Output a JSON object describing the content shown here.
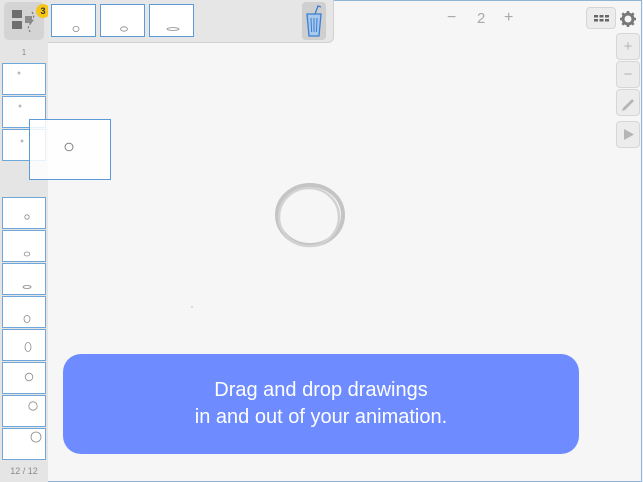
{
  "left_panel": {
    "layers_badge": "3",
    "top_frame_number": "1",
    "frame_count": "12 / 12"
  },
  "top_bar": {
    "frame_number": "2",
    "minus_label": "−",
    "plus_label": "+"
  },
  "side_toolbar": {
    "zoom_in_label": "+",
    "zoom_out_label": "−"
  },
  "callout": {
    "line1": "Drag and drop drawings",
    "line2": "in and out of your animation."
  },
  "colors": {
    "accent": "#6e8cff",
    "frame_border": "#5a9ad8",
    "badge": "#f5c518"
  }
}
